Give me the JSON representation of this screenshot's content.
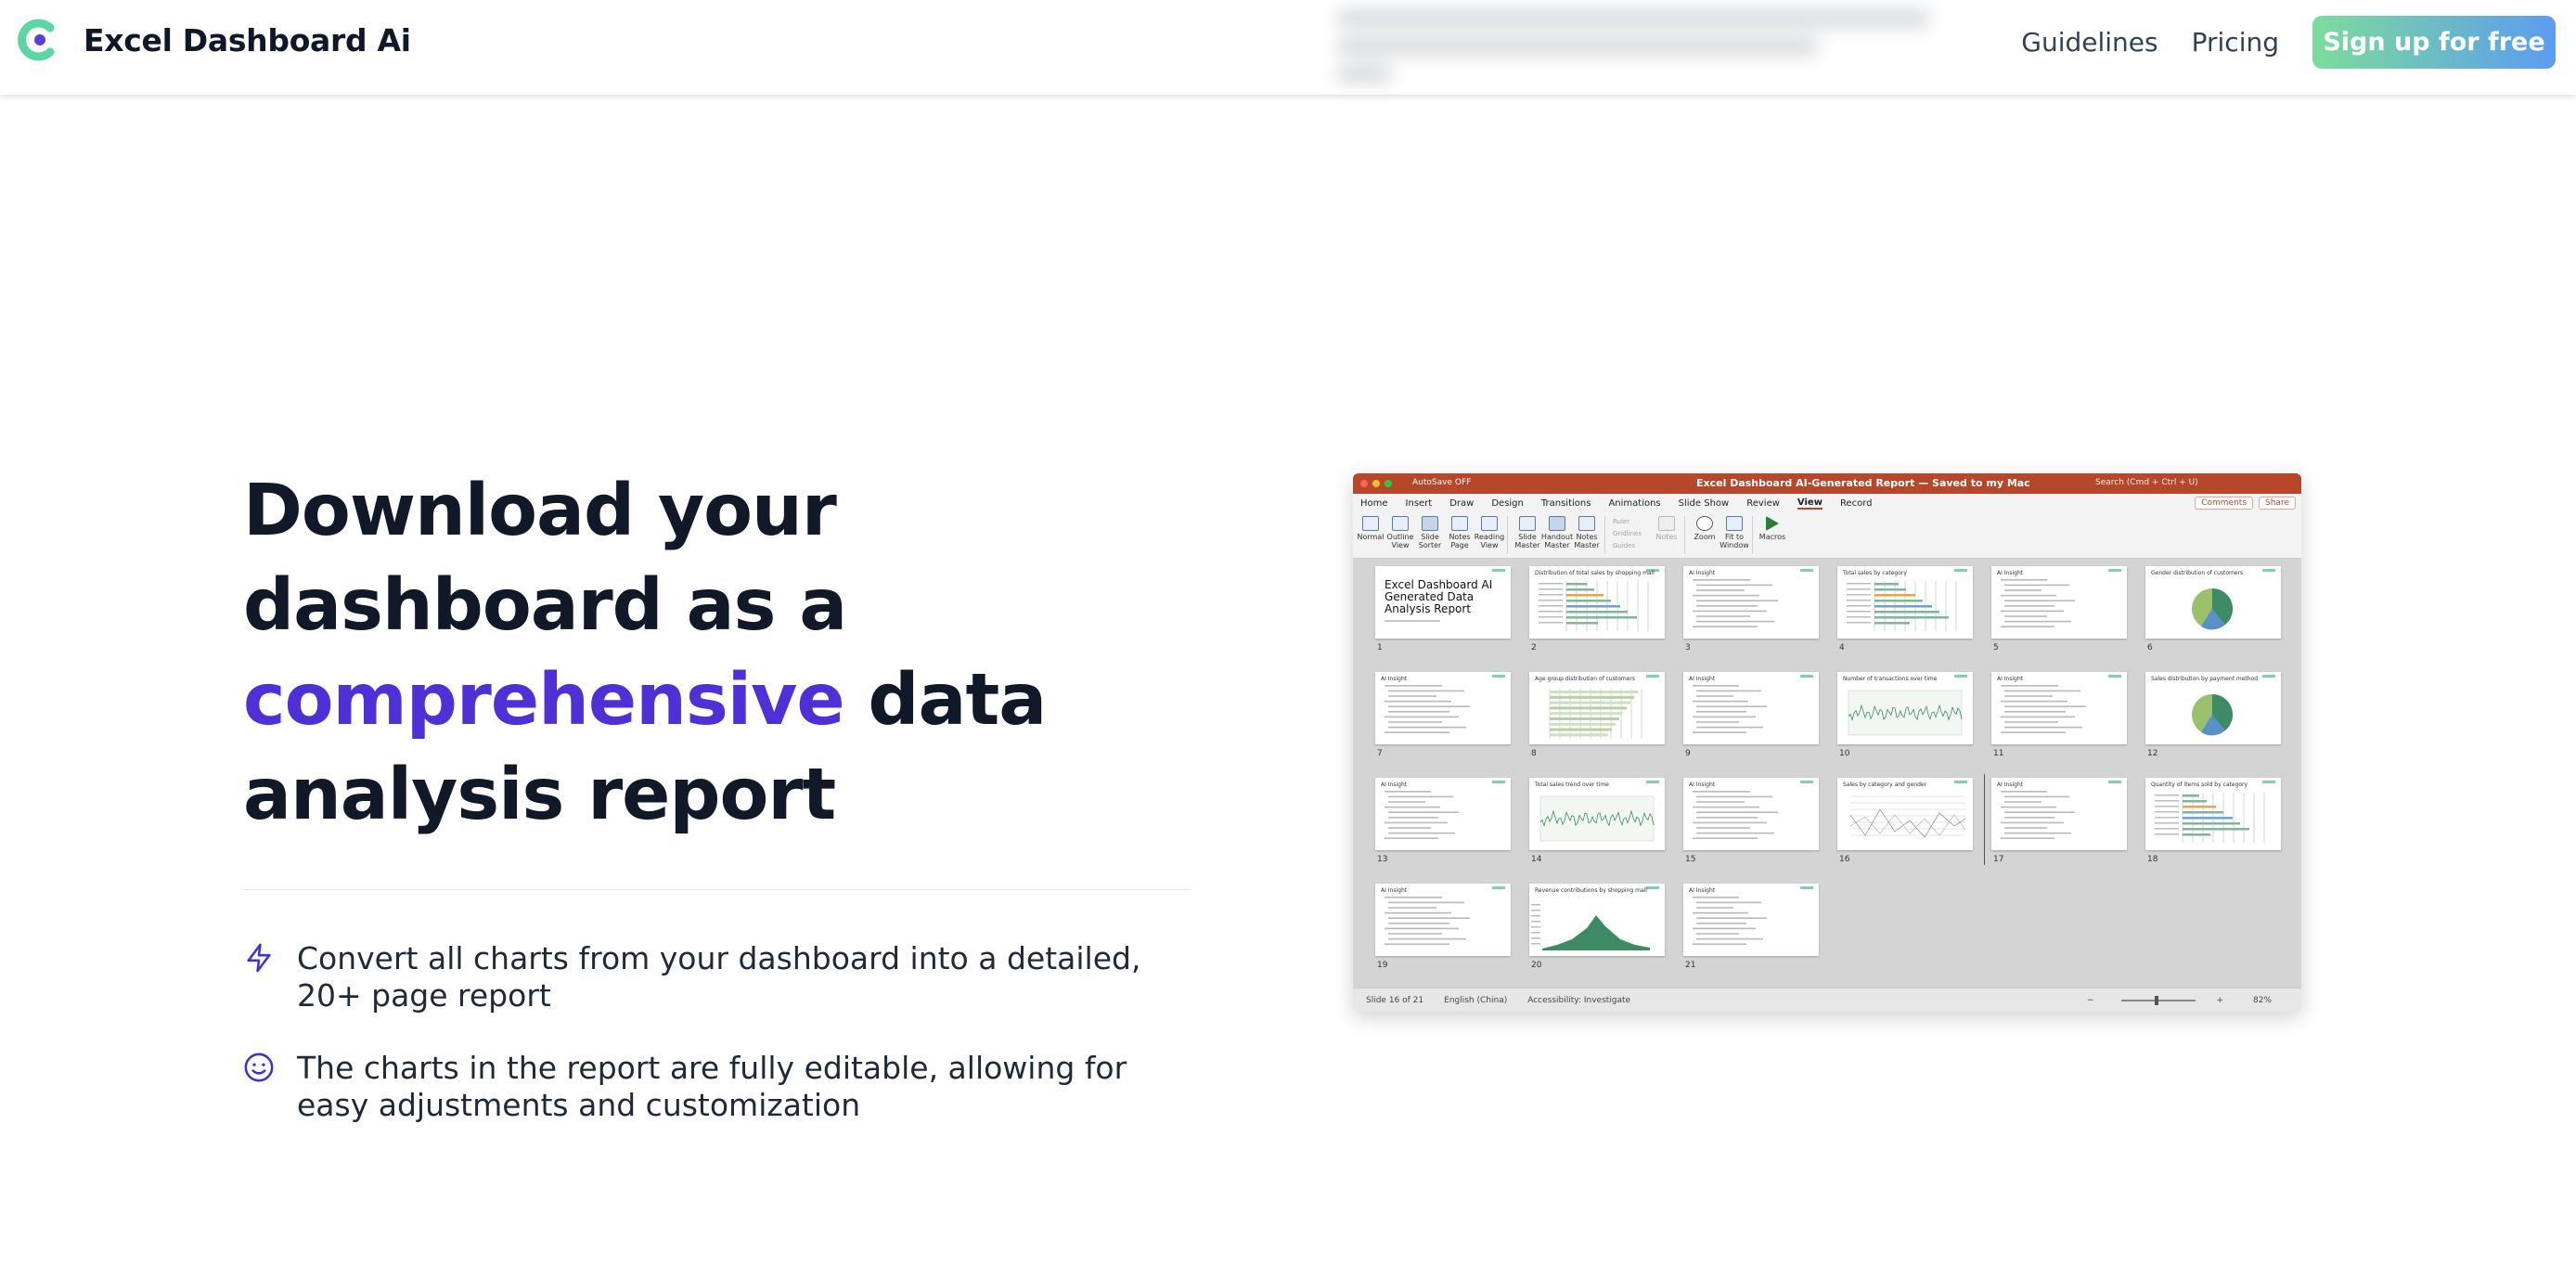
{
  "header": {
    "brand": "Excel Dashboard Ai",
    "nav": [
      "Guidelines",
      "Pricing"
    ],
    "signup_label": "Sign up for free",
    "brand_colors": {
      "logo_green": "#5ed6a4",
      "logo_purple": "#5b3fd6",
      "cta_start": "#7ddc9b",
      "cta_end": "#5b9cf0"
    }
  },
  "hero": {
    "headline_part1": "Download your dashboard as a ",
    "headline_accent": "comprehensive",
    "headline_part2": " data analysis report",
    "accent_color": "#4f2fd6",
    "features": [
      {
        "icon": "lightning-bolt-icon",
        "text": "Convert all charts from your dashboard into a detailed, 20+ page report"
      },
      {
        "icon": "smiley-face-icon",
        "text": "The charts in the report are fully editable, allowing for easy adjustments and customization"
      }
    ]
  },
  "ppt": {
    "autosave": "AutoSave",
    "autosave_state": "OFF",
    "doc_title": "Excel Dashboard AI-Generated Report — Saved to my Mac",
    "search_placeholder": "Search (Cmd + Ctrl + U)",
    "tabs": [
      "Home",
      "Insert",
      "Draw",
      "Design",
      "Transitions",
      "Animations",
      "Slide Show",
      "Review",
      "View",
      "Record"
    ],
    "active_tab": "View",
    "comments_label": "Comments",
    "share_label": "Share",
    "ribbon_views": [
      "Normal",
      "Outline View",
      "Slide Sorter",
      "Notes Page",
      "Reading View"
    ],
    "ribbon_masters": [
      "Slide Master",
      "Handout Master",
      "Notes Master"
    ],
    "ribbon_show": [
      "Ruler",
      "Gridlines",
      "Guides"
    ],
    "ribbon_notes": "Notes",
    "ribbon_zoom": [
      "Zoom",
      "Fit to Window"
    ],
    "ribbon_macros": "Macros",
    "title_slide_text": "Excel Dashboard AI Generated Data Analysis Report",
    "slides": [
      {
        "n": "1",
        "title": "",
        "kind": "title"
      },
      {
        "n": "2",
        "title": "Distribution of total sales by shopping mall",
        "kind": "hbar"
      },
      {
        "n": "3",
        "title": "AI Insight",
        "kind": "text"
      },
      {
        "n": "4",
        "title": "Total sales by category",
        "kind": "hbar"
      },
      {
        "n": "5",
        "title": "AI Insight",
        "kind": "text"
      },
      {
        "n": "6",
        "title": "Gender distribution of customers",
        "kind": "pie"
      },
      {
        "n": "7",
        "title": "AI Insight",
        "kind": "text"
      },
      {
        "n": "8",
        "title": "Age group distribution of customers",
        "kind": "grid"
      },
      {
        "n": "9",
        "title": "AI Insight",
        "kind": "text"
      },
      {
        "n": "10",
        "title": "Number of transactions over time",
        "kind": "line"
      },
      {
        "n": "11",
        "title": "AI Insight",
        "kind": "text"
      },
      {
        "n": "12",
        "title": "Sales distribution by payment method",
        "kind": "pie"
      },
      {
        "n": "13",
        "title": "AI Insight",
        "kind": "text"
      },
      {
        "n": "14",
        "title": "Total sales trend over time",
        "kind": "line"
      },
      {
        "n": "15",
        "title": "AI Insight",
        "kind": "text"
      },
      {
        "n": "16",
        "title": "Sales by category and gender",
        "kind": "multiline"
      },
      {
        "n": "17",
        "title": "AI Insight",
        "kind": "text"
      },
      {
        "n": "18",
        "title": "Quantity of items sold by category",
        "kind": "hbar"
      },
      {
        "n": "19",
        "title": "AI Insight",
        "kind": "text"
      },
      {
        "n": "20",
        "title": "Revenue contributions by shopping mall",
        "kind": "area"
      },
      {
        "n": "21",
        "title": "AI Insight",
        "kind": "text"
      }
    ],
    "status_slide": "Slide 16 of 21",
    "status_lang": "English (China)",
    "status_access": "Accessibility: Investigate",
    "zoom": "82%"
  }
}
